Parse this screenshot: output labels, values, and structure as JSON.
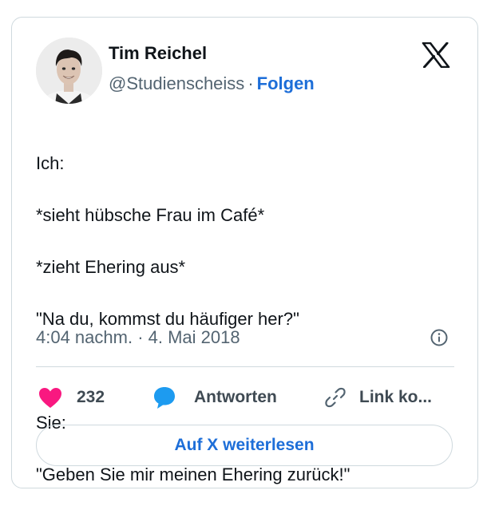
{
  "author": {
    "name": "Tim Reichel",
    "handle": "@Studienscheiss",
    "separator": "·",
    "follow_label": "Folgen"
  },
  "tweet": {
    "lines": [
      "Ich:",
      "*sieht hübsche Frau im Café*",
      "*zieht Ehering aus*",
      "\"Na du, kommst du häufiger her?\"",
      "",
      "Sie:",
      "\"Geben Sie mir meinen Ehering zurück!\""
    ],
    "timestamp": "4:04 nachm. · 4. Mai 2018"
  },
  "actions": {
    "likes": "232",
    "reply_label": "Antworten",
    "copy_link_label": "Link ko..."
  },
  "read_more_label": "Auf X weiterlesen",
  "icons": {
    "brand": "x-logo-icon",
    "info": "info-icon",
    "like": "heart-icon",
    "reply": "speech-bubble-icon",
    "link": "link-icon"
  },
  "colors": {
    "like_pink": "#f91880",
    "reply_blue": "#1d9bf0",
    "link_blue": "#1d6ed8",
    "secondary_text": "#536471",
    "border": "#cfd9de"
  }
}
